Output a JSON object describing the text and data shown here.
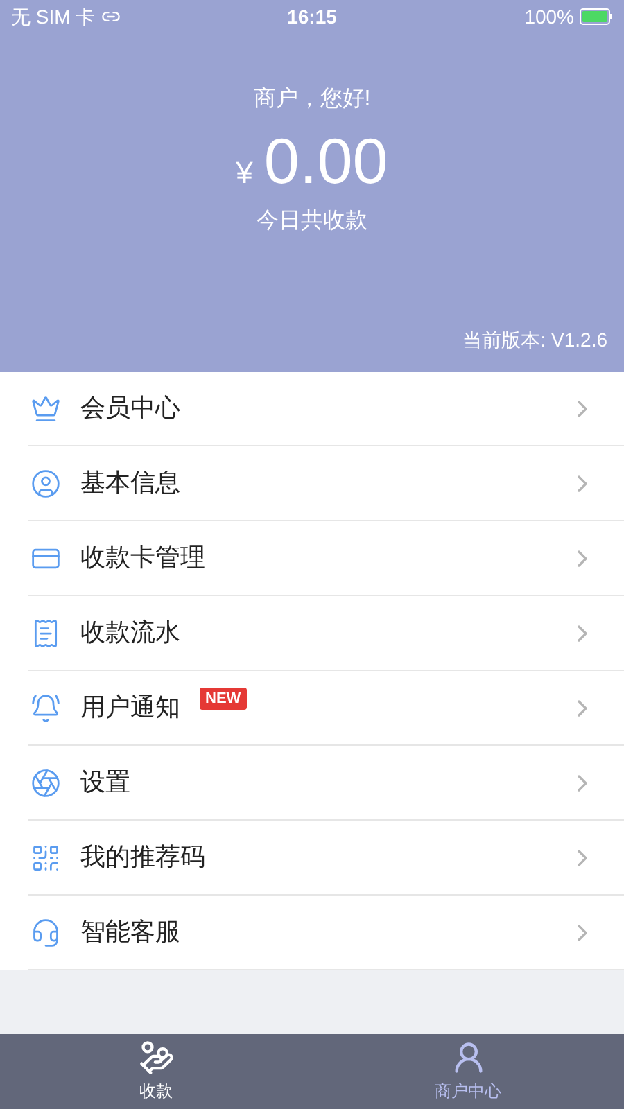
{
  "status_bar": {
    "carrier": "无 SIM 卡",
    "time": "16:15",
    "battery": "100%"
  },
  "header": {
    "greeting": "商户，您好!",
    "currency": "¥",
    "amount": "0.00",
    "amount_label": "今日共收款",
    "version": "当前版本: V1.2.6"
  },
  "menu": [
    {
      "kind": "crown",
      "label": "会员中心"
    },
    {
      "kind": "user",
      "label": "基本信息"
    },
    {
      "kind": "card",
      "label": "收款卡管理"
    },
    {
      "kind": "receipt",
      "label": "收款流水"
    },
    {
      "kind": "bell",
      "label": "用户通知",
      "badge": "NEW"
    },
    {
      "kind": "settings",
      "label": "设置"
    },
    {
      "kind": "qr",
      "label": "我的推荐码"
    },
    {
      "kind": "headset",
      "label": "智能客服"
    }
  ],
  "tab_bar": [
    {
      "kind": "payment",
      "label": "收款",
      "selected": false
    },
    {
      "kind": "merchant",
      "label": "商户中心",
      "selected": true
    }
  ]
}
